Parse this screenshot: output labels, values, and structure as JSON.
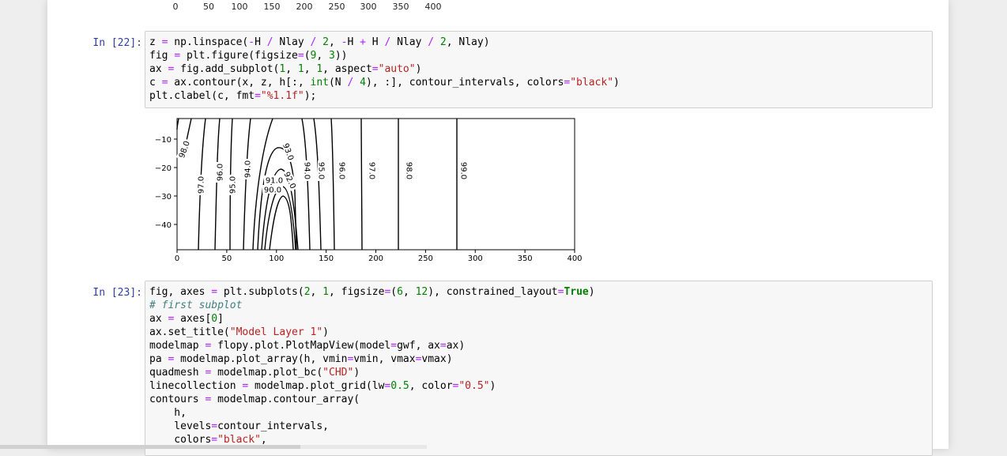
{
  "previous_output_axis": {
    "ticks": [
      "0",
      "50",
      "100",
      "150",
      "200",
      "250",
      "300",
      "350",
      "400"
    ]
  },
  "cells": [
    {
      "prompt": "In [22]:",
      "lines": [
        [
          [
            "z ",
            ""
          ],
          [
            "=",
            "op"
          ],
          [
            " np.linspace(",
            ""
          ],
          [
            "-",
            "op"
          ],
          [
            "H ",
            ""
          ],
          [
            "/",
            "op"
          ],
          [
            " Nlay ",
            ""
          ],
          [
            "/",
            "op"
          ],
          [
            " ",
            ""
          ],
          [
            "2",
            "num"
          ],
          [
            ", ",
            ""
          ],
          [
            "-",
            "op"
          ],
          [
            "H ",
            ""
          ],
          [
            "+",
            "op"
          ],
          [
            " H ",
            ""
          ],
          [
            "/",
            "op"
          ],
          [
            " Nlay ",
            ""
          ],
          [
            "/",
            "op"
          ],
          [
            " ",
            ""
          ],
          [
            "2",
            "num"
          ],
          [
            ", Nlay)",
            ""
          ]
        ],
        [
          [
            "fig ",
            ""
          ],
          [
            "=",
            "op"
          ],
          [
            " plt.figure(figsize",
            ""
          ],
          [
            "=",
            "op"
          ],
          [
            "(",
            ""
          ],
          [
            "9",
            "num"
          ],
          [
            ", ",
            ""
          ],
          [
            "3",
            "num"
          ],
          [
            "))",
            ""
          ]
        ],
        [
          [
            "ax ",
            ""
          ],
          [
            "=",
            "op"
          ],
          [
            " fig.add_subplot(",
            ""
          ],
          [
            "1",
            "num"
          ],
          [
            ", ",
            ""
          ],
          [
            "1",
            "num"
          ],
          [
            ", ",
            ""
          ],
          [
            "1",
            "num"
          ],
          [
            ", aspect",
            ""
          ],
          [
            "=",
            "op"
          ],
          [
            "\"auto\"",
            "str"
          ],
          [
            ")",
            ""
          ]
        ],
        [
          [
            "c ",
            ""
          ],
          [
            "=",
            "op"
          ],
          [
            " ax.contour(x, z, h[:, ",
            ""
          ],
          [
            "int",
            "bi"
          ],
          [
            "(N ",
            ""
          ],
          [
            "/",
            "op"
          ],
          [
            " ",
            ""
          ],
          [
            "4",
            "num"
          ],
          [
            "), :], contour_intervals, colors",
            ""
          ],
          [
            "=",
            "op"
          ],
          [
            "\"black\"",
            "str"
          ],
          [
            ")",
            ""
          ]
        ],
        [
          [
            "plt.clabel(c, fmt",
            ""
          ],
          [
            "=",
            "op"
          ],
          [
            "\"%1.1f\"",
            "str"
          ],
          [
            ");",
            ""
          ]
        ]
      ]
    },
    {
      "prompt": "In [23]:",
      "lines": [
        [
          [
            "fig, axes ",
            ""
          ],
          [
            "=",
            "op"
          ],
          [
            " plt.subplots(",
            ""
          ],
          [
            "2",
            "num"
          ],
          [
            ", ",
            ""
          ],
          [
            "1",
            "num"
          ],
          [
            ", figsize",
            ""
          ],
          [
            "=",
            "op"
          ],
          [
            "(",
            ""
          ],
          [
            "6",
            "num"
          ],
          [
            ", ",
            ""
          ],
          [
            "12",
            "num"
          ],
          [
            "), constrained_layout",
            ""
          ],
          [
            "=",
            "op"
          ],
          [
            "True",
            "kw"
          ],
          [
            ")",
            ""
          ]
        ],
        [
          [
            "# first subplot",
            "com"
          ]
        ],
        [
          [
            "ax ",
            ""
          ],
          [
            "=",
            "op"
          ],
          [
            " axes[",
            ""
          ],
          [
            "0",
            "num"
          ],
          [
            "]",
            ""
          ]
        ],
        [
          [
            "ax.set_title(",
            ""
          ],
          [
            "\"Model Layer 1\"",
            "str"
          ],
          [
            ")",
            ""
          ]
        ],
        [
          [
            "modelmap ",
            ""
          ],
          [
            "=",
            "op"
          ],
          [
            " flopy.plot.PlotMapView(model",
            ""
          ],
          [
            "=",
            "op"
          ],
          [
            "gwf, ax",
            ""
          ],
          [
            "=",
            "op"
          ],
          [
            "ax)",
            ""
          ]
        ],
        [
          [
            "pa ",
            ""
          ],
          [
            "=",
            "op"
          ],
          [
            " modelmap.plot_array(h, vmin",
            ""
          ],
          [
            "=",
            "op"
          ],
          [
            "vmin, vmax",
            ""
          ],
          [
            "=",
            "op"
          ],
          [
            "vmax)",
            ""
          ]
        ],
        [
          [
            "quadmesh ",
            ""
          ],
          [
            "=",
            "op"
          ],
          [
            " modelmap.plot_bc(",
            ""
          ],
          [
            "\"CHD\"",
            "str"
          ],
          [
            ")",
            ""
          ]
        ],
        [
          [
            "linecollection ",
            ""
          ],
          [
            "=",
            "op"
          ],
          [
            " modelmap.plot_grid(lw",
            ""
          ],
          [
            "=",
            "op"
          ],
          [
            "0.5",
            "num"
          ],
          [
            ", color",
            ""
          ],
          [
            "=",
            "op"
          ],
          [
            "\"0.5\"",
            "str"
          ],
          [
            ")",
            ""
          ]
        ],
        [
          [
            "contours ",
            ""
          ],
          [
            "=",
            "op"
          ],
          [
            " modelmap.contour_array(",
            ""
          ]
        ],
        [
          [
            "    h,",
            ""
          ]
        ],
        [
          [
            "    levels",
            ""
          ],
          [
            "=",
            "op"
          ],
          [
            "contour_intervals,",
            ""
          ]
        ],
        [
          [
            "    colors",
            ""
          ],
          [
            "=",
            "op"
          ],
          [
            "\"black\"",
            "str"
          ],
          [
            ",",
            ""
          ]
        ]
      ]
    }
  ],
  "contour_plot": {
    "x_ticks": [
      "0",
      "50",
      "100",
      "150",
      "200",
      "250",
      "300",
      "350",
      "400"
    ],
    "y_ticks": [
      "−10",
      "−20",
      "−30",
      "−40"
    ],
    "labels": [
      "98.0",
      "97.0",
      "96.0",
      "95.0",
      "94.0",
      "93.0",
      "92.0",
      "91.0",
      "90.0",
      "94.0",
      "95.0",
      "96.0",
      "97.0",
      "98.0",
      "99.0"
    ]
  }
}
